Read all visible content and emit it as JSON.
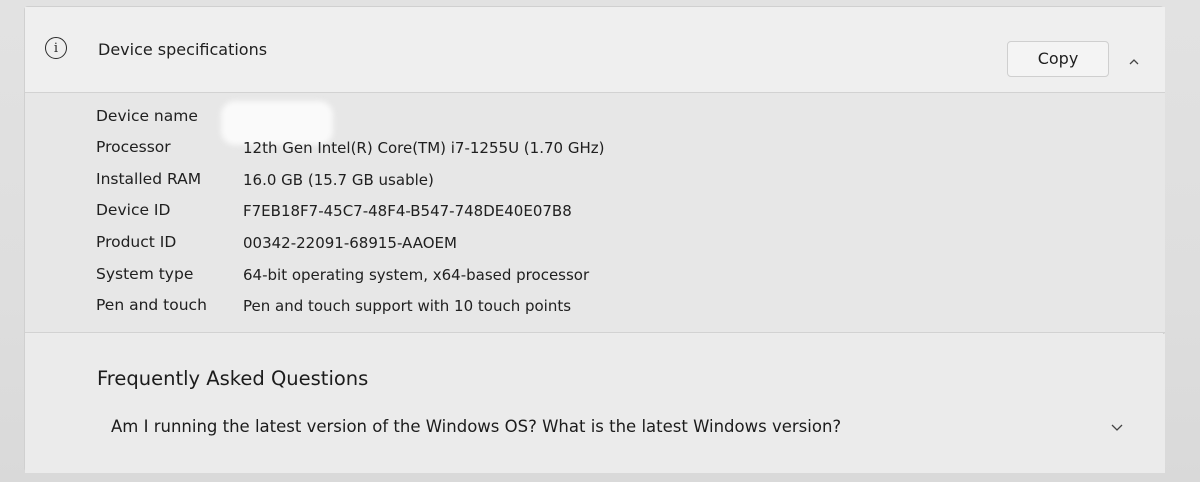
{
  "header": {
    "icon": "info-icon",
    "icon_glyph": "i",
    "title": "Device specifications",
    "copy_label": "Copy",
    "collapse_icon": "chevron-up-icon"
  },
  "specs": [
    {
      "label": "Device name",
      "value": ""
    },
    {
      "label": "Processor",
      "value": "12th Gen Intel(R) Core(TM) i7-1255U (1.70 GHz)"
    },
    {
      "label": "Installed RAM",
      "value": "16.0 GB (15.7 GB usable)"
    },
    {
      "label": "Device ID",
      "value": "F7EB18F7-45C7-48F4-B547-748DE40E07B8"
    },
    {
      "label": "Product ID",
      "value": "00342-22091-68915-AAOEM"
    },
    {
      "label": "System type",
      "value": "64-bit operating system, x64-based processor"
    },
    {
      "label": "Pen and touch",
      "value": "Pen and touch support with 10 touch points"
    }
  ],
  "faq": {
    "title": "Frequently Asked Questions",
    "question": "Am I running the latest version of the Windows OS? What is the latest Windows version?",
    "expand_icon": "chevron-down-icon"
  }
}
